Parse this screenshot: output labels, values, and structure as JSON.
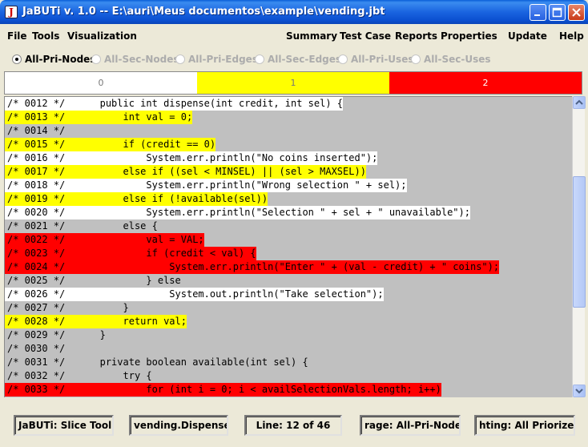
{
  "window": {
    "title": "JaBUTi v. 1.0 -- E:\\auri\\Meus documentos\\example\\vending.jbt",
    "app_icon": "J"
  },
  "menu": {
    "left": [
      "File",
      "Tools",
      "Visualization"
    ],
    "right": [
      "Summary",
      "Test Case",
      "Reports",
      "Properties",
      "Update",
      "Help"
    ]
  },
  "criteria": [
    {
      "label": "All-Pri-Nodes",
      "selected": true,
      "enabled": true
    },
    {
      "label": "All-Sec-Nodes",
      "selected": false,
      "enabled": false
    },
    {
      "label": "All-Pri-Edges",
      "selected": false,
      "enabled": false
    },
    {
      "label": "All-Sec-Edges",
      "selected": false,
      "enabled": false
    },
    {
      "label": "All-Pri-Uses",
      "selected": false,
      "enabled": false
    },
    {
      "label": "All-Sec-Uses",
      "selected": false,
      "enabled": false
    }
  ],
  "legend": [
    {
      "label": "0",
      "color": "#ffffff"
    },
    {
      "label": "1",
      "color": "#ffff00"
    },
    {
      "label": "2",
      "color": "#ff0000"
    }
  ],
  "code_lines": [
    {
      "num": "/* 0012 */",
      "code": "    public int dispense(int credit, int sel) {",
      "color": "white"
    },
    {
      "num": "/* 0013 */",
      "code": "        int val = 0;",
      "color": "yellow"
    },
    {
      "num": "/* 0014 */",
      "code": "",
      "color": "gray"
    },
    {
      "num": "/* 0015 */",
      "code": "        if (credit == 0)",
      "color": "yellow"
    },
    {
      "num": "/* 0016 */",
      "code": "            System.err.println(\"No coins inserted\");",
      "color": "white"
    },
    {
      "num": "/* 0017 */",
      "code": "        else if ((sel < MINSEL) || (sel > MAXSEL))",
      "color": "yellow"
    },
    {
      "num": "/* 0018 */",
      "code": "            System.err.println(\"Wrong selection \" + sel);",
      "color": "white"
    },
    {
      "num": "/* 0019 */",
      "code": "        else if (!available(sel))",
      "color": "yellow"
    },
    {
      "num": "/* 0020 */",
      "code": "            System.err.println(\"Selection \" + sel + \" unavailable\");",
      "color": "white"
    },
    {
      "num": "/* 0021 */",
      "code": "        else {",
      "color": "gray"
    },
    {
      "num": "/* 0022 */",
      "code": "            val = VAL;",
      "color": "red"
    },
    {
      "num": "/* 0023 */",
      "code": "            if (credit < val) {",
      "color": "red"
    },
    {
      "num": "/* 0024 */",
      "code": "                System.err.println(\"Enter \" + (val - credit) + \" coins\");",
      "color": "red"
    },
    {
      "num": "/* 0025 */",
      "code": "            } else",
      "color": "gray"
    },
    {
      "num": "/* 0026 */",
      "code": "                System.out.println(\"Take selection\");",
      "color": "white"
    },
    {
      "num": "/* 0027 */",
      "code": "        }",
      "color": "gray"
    },
    {
      "num": "/* 0028 */",
      "code": "        return val;",
      "color": "yellow"
    },
    {
      "num": "/* 0029 */",
      "code": "    }",
      "color": "gray"
    },
    {
      "num": "/* 0030 */",
      "code": "",
      "color": "gray"
    },
    {
      "num": "/* 0031 */",
      "code": "    private boolean available(int sel) {",
      "color": "gray"
    },
    {
      "num": "/* 0032 */",
      "code": "        try {",
      "color": "gray"
    },
    {
      "num": "/* 0033 */",
      "code": "            for (int i = 0; i < availSelectionVals.length; i++)",
      "color": "red"
    }
  ],
  "status": {
    "tool": "JaBUTi: Slice Tool",
    "class": "vending.Dispenser",
    "line": "Line: 12 of 46",
    "coverage": "rage: All-Pri-Nodes",
    "highlighting": "hting: All Priorized"
  },
  "scrollbar_position": 0.2
}
